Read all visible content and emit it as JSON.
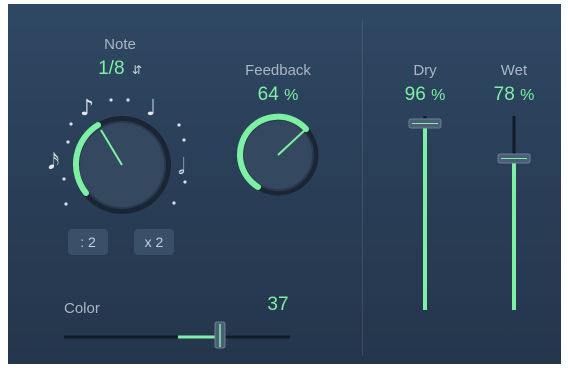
{
  "colors": {
    "accent": "#7df0a4",
    "label": "#aab6c4",
    "panel_top": "#2f4863",
    "panel_bottom": "#24364c"
  },
  "note": {
    "label": "Note",
    "value": "1/8",
    "chevron_icon": "up-down-chevron-icon",
    "note_icons": [
      "sixteenth-note-icon",
      "eighth-note-icon",
      "quarter-note-icon",
      "half-note-icon"
    ],
    "half_button": ": 2",
    "double_button": "x 2"
  },
  "feedback": {
    "label": "Feedback",
    "value": "64",
    "unit": "%",
    "level_percent": 64
  },
  "color": {
    "label": "Color",
    "value": "37"
  },
  "dry": {
    "label": "Dry",
    "value": "96",
    "unit": "%",
    "level_percent": 96
  },
  "wet": {
    "label": "Wet",
    "value": "78",
    "unit": "%",
    "level_percent": 78
  }
}
